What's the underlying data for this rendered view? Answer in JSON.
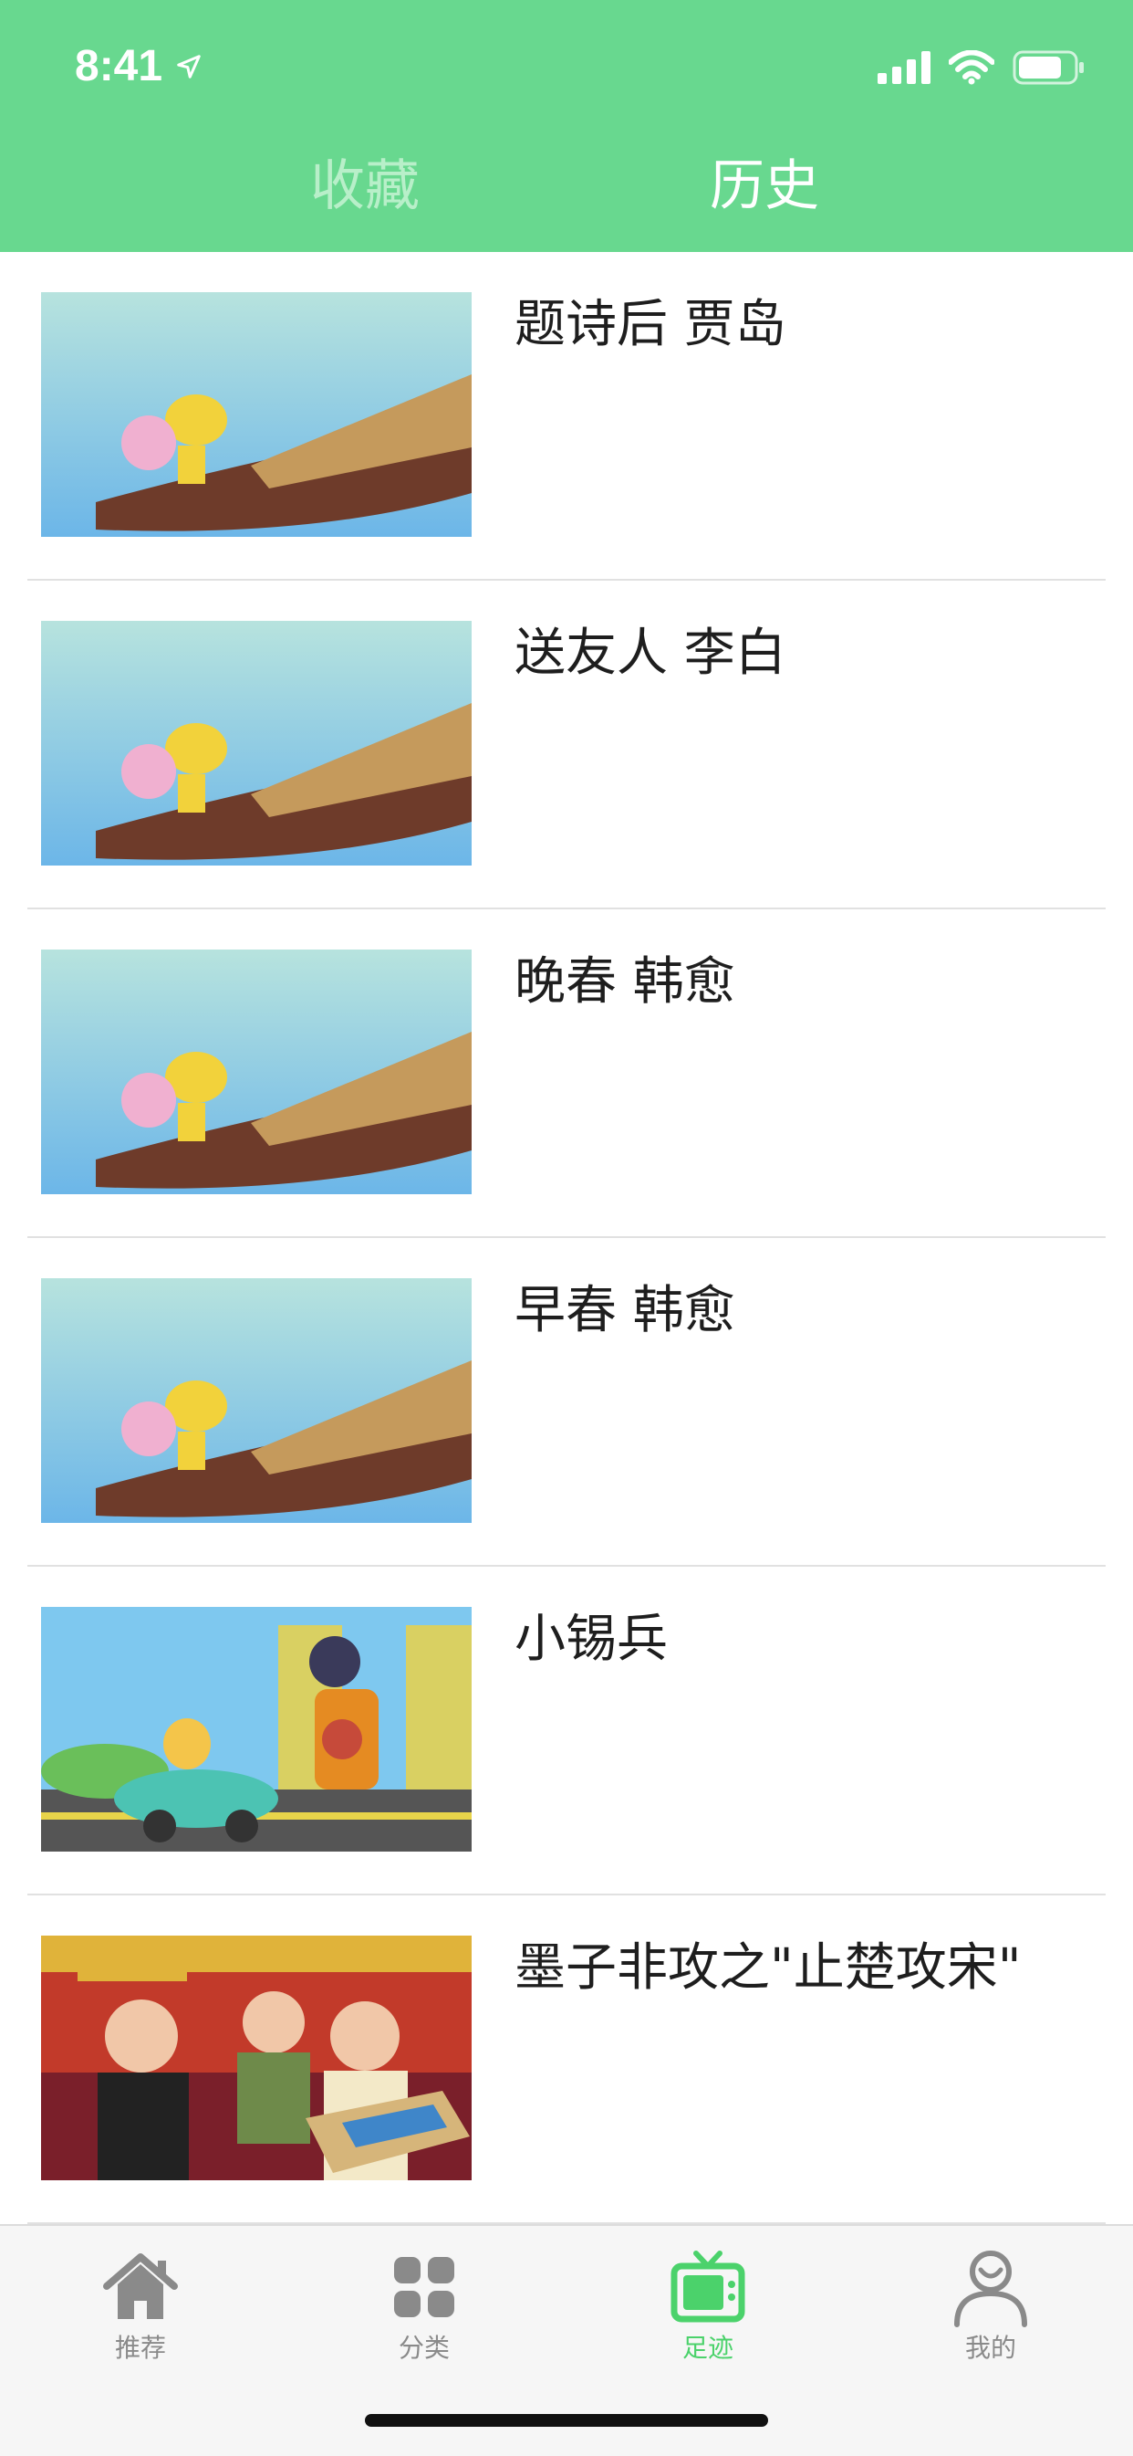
{
  "status_bar": {
    "time": "8:41"
  },
  "header": {
    "tabs": [
      {
        "label": "收藏",
        "active": false
      },
      {
        "label": "历史",
        "active": true
      }
    ]
  },
  "list": [
    {
      "title": "题诗后 贾岛"
    },
    {
      "title": "送友人 李白"
    },
    {
      "title": "晚春 韩愈"
    },
    {
      "title": "早春 韩愈"
    },
    {
      "title": "小锡兵"
    },
    {
      "title": "墨子非攻之\"止楚攻宋\""
    }
  ],
  "tabbar": {
    "items": [
      {
        "label": "推荐",
        "icon": "home-icon",
        "active": false
      },
      {
        "label": "分类",
        "icon": "grid-icon",
        "active": false
      },
      {
        "label": "足迹",
        "icon": "tv-icon",
        "active": true
      },
      {
        "label": "我的",
        "icon": "user-icon",
        "active": false
      }
    ]
  },
  "colors": {
    "header_green": "#68d88f",
    "active_tab_green": "#4bd26b",
    "inactive_gray": "#8a8a8a"
  }
}
